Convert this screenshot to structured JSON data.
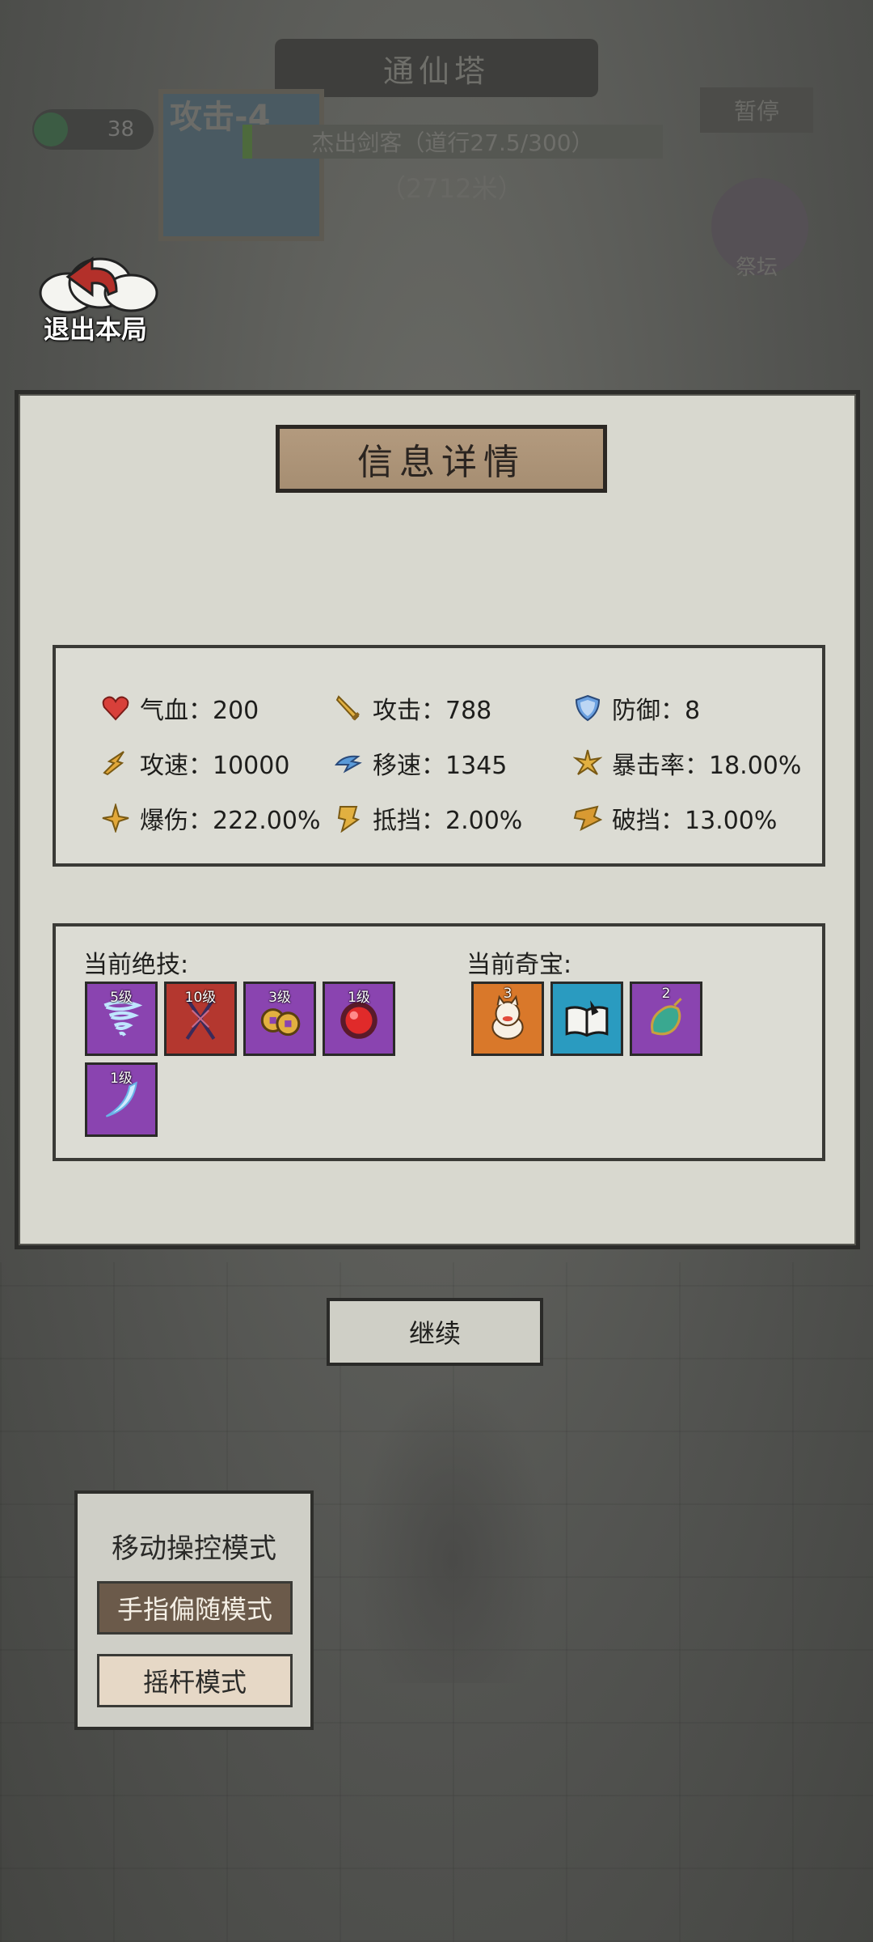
{
  "hud": {
    "tower_title": "通仙塔",
    "coin_count": "38",
    "attack_tag": "攻击-4",
    "rank": "杰出剑客（道行27.5/300）",
    "distance": "（2712米）",
    "pause_label": "暂停",
    "altar_label": "祭坛"
  },
  "exit": {
    "label": "退出本局"
  },
  "panel": {
    "title": "信息详情",
    "stats": [
      {
        "icon": "heart-icon",
        "label": "气血：200"
      },
      {
        "icon": "sword-icon",
        "label": "攻击：788"
      },
      {
        "icon": "shield-icon",
        "label": "防御：8"
      },
      {
        "icon": "attack-speed-icon",
        "label": "攻速：10000"
      },
      {
        "icon": "move-speed-icon",
        "label": "移速：1345"
      },
      {
        "icon": "crit-rate-icon",
        "label": "暴击率：18.00%"
      },
      {
        "icon": "crit-damage-icon",
        "label": "爆伤：222.00%"
      },
      {
        "icon": "block-icon",
        "label": "抵挡：2.00%"
      },
      {
        "icon": "pierce-block-icon",
        "label": "破挡：13.00%"
      }
    ],
    "skills_label": "当前绝技:",
    "treasures_label": "当前奇宝:",
    "skills": [
      {
        "icon": "tornado-icon",
        "level": "5级",
        "color": "#8a44b0"
      },
      {
        "icon": "thunder-spear-icon",
        "level": "10级",
        "color": "#b4372f"
      },
      {
        "icon": "coins-icon",
        "level": "3级",
        "color": "#8a44b0"
      },
      {
        "icon": "red-orb-icon",
        "level": "1级",
        "color": "#8a44b0"
      },
      {
        "icon": "wind-slash-icon",
        "level": "1级",
        "color": "#8a44b0"
      }
    ],
    "treasures": [
      {
        "icon": "lucky-cat-icon",
        "count": "3",
        "color": "#d9782a"
      },
      {
        "icon": "open-book-icon",
        "count": "",
        "color": "#2a9bc0"
      },
      {
        "icon": "jade-ornament-icon",
        "count": "2",
        "color": "#8a44b0"
      }
    ]
  },
  "continue_label": "继续",
  "control": {
    "title": "移动操控模式",
    "mode_follow": "手指偏随模式",
    "mode_joystick": "摇杆模式"
  }
}
